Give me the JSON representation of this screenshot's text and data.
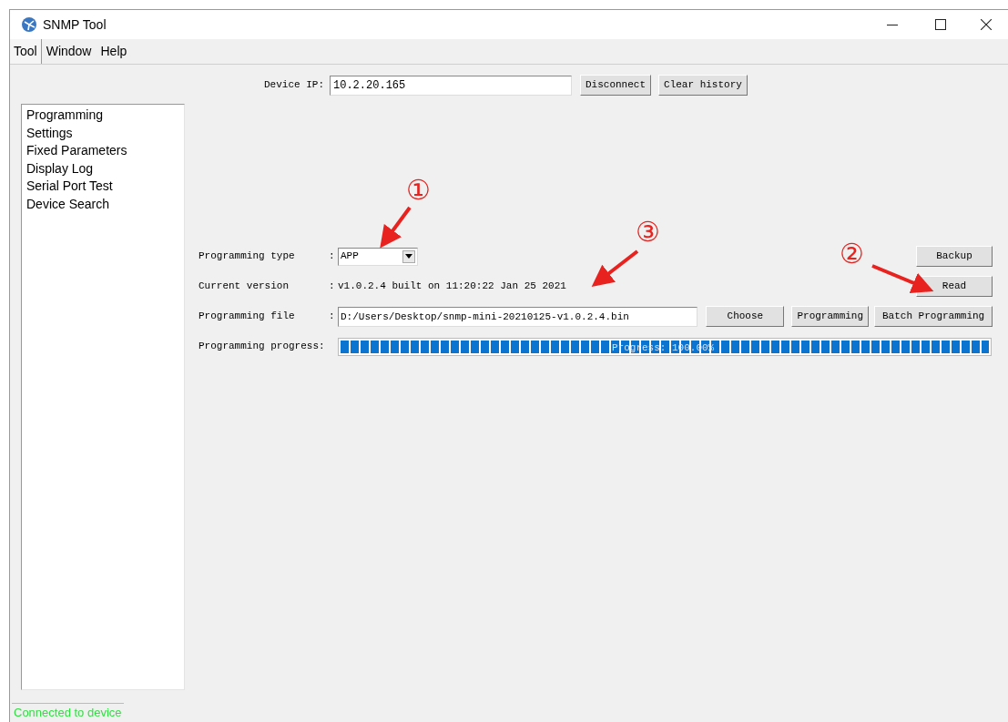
{
  "window": {
    "title": "SNMP Tool"
  },
  "menu": [
    {
      "label": "Tool",
      "selected": true
    },
    {
      "label": "Window",
      "selected": false
    },
    {
      "label": "Help",
      "selected": false
    }
  ],
  "device_ip": {
    "label": "Device IP:",
    "value": "10.2.20.165",
    "buttons": [
      "Disconnect",
      "Clear history"
    ]
  },
  "sidebar": {
    "items": [
      {
        "label": "Programming"
      },
      {
        "label": "Settings"
      },
      {
        "label": "Fixed Parameters"
      },
      {
        "label": "Display Log"
      },
      {
        "label": "Serial Port Test"
      },
      {
        "label": "Device Search"
      }
    ]
  },
  "form": {
    "rows": [
      {
        "kind": "select",
        "label": "Programming type",
        "separator": ":",
        "value": "APP",
        "buttons": [
          "Backup"
        ]
      },
      {
        "kind": "text",
        "label": "Current version",
        "separator": ":",
        "value": "v1.0.2.4 built on 11:20:22 Jan 25 2021",
        "buttons": [
          "Read"
        ]
      },
      {
        "kind": "file",
        "label": "Programming file",
        "separator": ":",
        "value": "D:/Users/Desktop/snmp-mini-20210125-v1.0.2.4.bin",
        "buttons": [
          "Choose",
          "Programming",
          "Batch Programming"
        ]
      },
      {
        "kind": "progress",
        "label": "Programming progress:",
        "level": 1.0,
        "reading": "Progress: 100.00%"
      }
    ]
  },
  "annotations": [
    {
      "label": "①"
    },
    {
      "label": "②"
    },
    {
      "label": "③"
    }
  ],
  "status_bar": {
    "text": "Connected to device"
  }
}
